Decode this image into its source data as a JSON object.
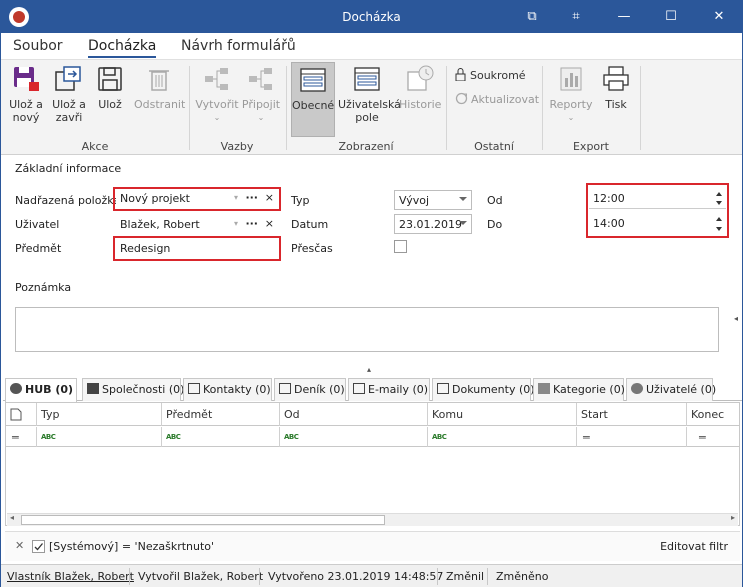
{
  "window": {
    "title": "Docházka",
    "controls": {
      "pin": "⧉",
      "restore": "⌗",
      "minimize": "—",
      "maximize": "☐",
      "close": "✕"
    }
  },
  "menu": {
    "items": [
      "Soubor",
      "Docházka",
      "Návrh formulářů"
    ],
    "active": "Docházka"
  },
  "ribbon": {
    "akce": {
      "label": "Akce",
      "buttons": [
        "Ulož a\nnový",
        "Ulož a\nzavři",
        "Ulož",
        "Odstranit"
      ]
    },
    "vazby": {
      "label": "Vazby",
      "buttons": [
        "Vytvořit",
        "Připojit"
      ]
    },
    "zobrazeni": {
      "label": "Zobrazení",
      "buttons": [
        "Obecné",
        "Uživatelská\npole",
        "Historie"
      ]
    },
    "ostatni": {
      "label": "Ostatní",
      "soukrome": "Soukromé",
      "aktualizovat": "Aktualizovat"
    },
    "export": {
      "label": "Export",
      "buttons": [
        "Reporty",
        "Tisk"
      ]
    }
  },
  "form": {
    "section_title": "Základní informace",
    "nadrazena_label": "Nadřazená položka",
    "nadrazena_value": "Nový projekt",
    "uzivatel_label": "Uživatel",
    "uzivatel_value": "Blažek, Robert",
    "predmet_label": "Předmět",
    "predmet_value": "Redesign",
    "typ_label": "Typ",
    "typ_value": "Vývoj",
    "datum_label": "Datum",
    "datum_value": "23.01.2019",
    "prescas_label": "Přesčas",
    "od_label": "Od",
    "od_value": "12:00",
    "do_label": "Do",
    "do_value": "14:00",
    "poznamka_label": "Poznámka",
    "ellipsis": "···",
    "clear": "×"
  },
  "tabs": [
    "HUB (0)",
    "Společnosti (0)",
    "Kontakty (0)",
    "Deník (0)",
    "E-maily (0)",
    "Dokumenty (0)",
    "Kategorie (0)",
    "Uživatelé (0)"
  ],
  "grid": {
    "columns": [
      "Typ",
      "Předmět",
      "Od",
      "Komu",
      "Start",
      "Konec"
    ],
    "filter_text_icon": "ABC"
  },
  "filter": {
    "text": "[Systémový] = 'Nezaškrtnuto'",
    "edit_label": "Editovat filtr",
    "close": "✕"
  },
  "status": {
    "vlastnik": "Vlastník Blažek, Robert",
    "vytvoril": "Vytvořil Blažek, Robert",
    "vytvoreno": "Vytvořeno 23.01.2019 14:48:57",
    "zmenil": "Změnil",
    "zmeneno": "Změněno"
  },
  "colors": {
    "titlebar": "#2b579a",
    "highlight": "#d9262c"
  }
}
